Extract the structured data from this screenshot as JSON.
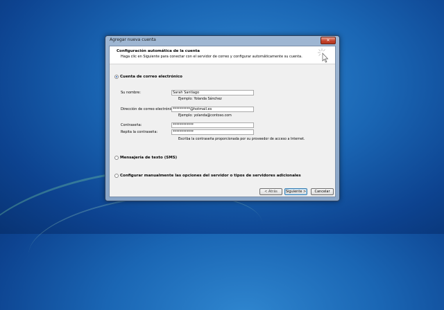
{
  "window": {
    "title": "Agregar nueva cuenta",
    "close_glyph": "✕"
  },
  "header": {
    "title": "Configuración automática de la cuenta",
    "description": "Haga clic en Siguiente para conectar con el servidor de correo y configurar automáticamente su cuenta.",
    "icon": "cursor-arrow-icon"
  },
  "email_option": {
    "label": "Cuenta de correo electrónico",
    "selected": true,
    "fields": {
      "name_label": "Su nombre:",
      "name_value": "Sarah Santiago",
      "name_hint": "Ejemplo: Yolanda Sánchez",
      "email_label": "Dirección de correo electrónico:",
      "email_value": "**********@hotmail.es",
      "email_hint": "Ejemplo: yolanda@contoso.com",
      "password_label": "Contraseña:",
      "password_value": "************",
      "confirm_label": "Repita la contraseña:",
      "confirm_value": "************",
      "password_hint": "Escriba la contraseña proporcionada por su proveedor de acceso a Internet."
    }
  },
  "sms_option": {
    "label": "Mensajería de texto (SMS)",
    "selected": false
  },
  "manual_option": {
    "label": "Configurar manualmente las opciones del servidor o tipos de servidores adicionales",
    "selected": false
  },
  "buttons": {
    "back": "< Atrás",
    "next": "Siguiente >",
    "cancel": "Cancelar"
  }
}
